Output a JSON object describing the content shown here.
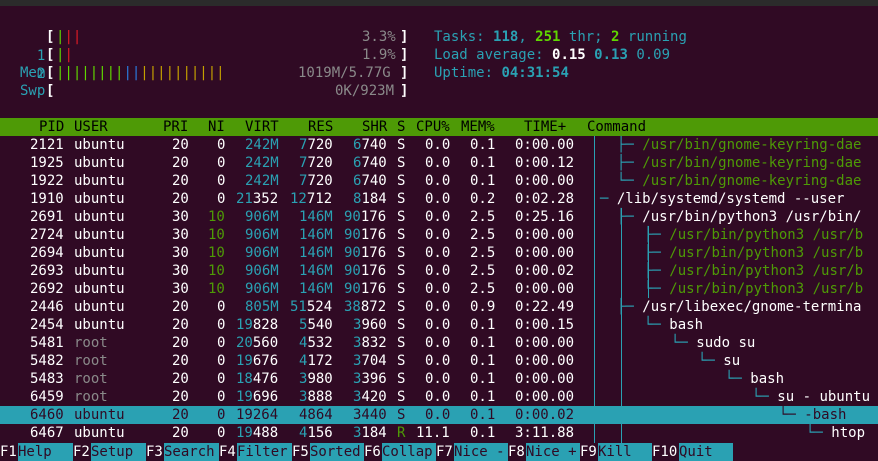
{
  "meters": {
    "cpu1": {
      "label": "1",
      "bars": "|||",
      "value": "3.3%"
    },
    "cpu2": {
      "label": "2",
      "bars": "||",
      "value": "1.9%"
    },
    "mem": {
      "label": "Mem",
      "bars": "||||||||||||||||||||",
      "value": "1019M/5.77G"
    },
    "swp": {
      "label": "Swp",
      "bars": "",
      "value": "0K/923M"
    }
  },
  "stats": {
    "tasks_label": "Tasks: ",
    "tasks": "118",
    "thr": "251",
    "thr_label": " thr; ",
    "running": "2",
    "running_label": " running",
    "load_label": "Load average: ",
    "load1": "0.15",
    "load5": "0.13",
    "load15": "0.09",
    "uptime_label": "Uptime: ",
    "uptime": "04:31:54"
  },
  "columns": [
    "PID",
    "USER",
    "PRI",
    "NI",
    "VIRT",
    "RES",
    "SHR",
    "S",
    "CPU%",
    "MEM%",
    "TIME+",
    "Command"
  ],
  "rows": [
    {
      "pid": "2121",
      "user": "ubuntu",
      "pri": "20",
      "ni": "0",
      "virt": "242M",
      "res": "7720",
      "shr": "6740",
      "s": "S",
      "cpu": "0.0",
      "mem": "0.1",
      "time": "0:00.00",
      "cmd": "/usr/bin/gnome-keyring-dae",
      "level": 1,
      "tree": "├─ ",
      "green": true
    },
    {
      "pid": "1925",
      "user": "ubuntu",
      "pri": "20",
      "ni": "0",
      "virt": "242M",
      "res": "7720",
      "shr": "6740",
      "s": "S",
      "cpu": "0.0",
      "mem": "0.1",
      "time": "0:00.12",
      "cmd": "/usr/bin/gnome-keyring-dae",
      "level": 1,
      "tree": "├─ ",
      "green": true
    },
    {
      "pid": "1922",
      "user": "ubuntu",
      "pri": "20",
      "ni": "0",
      "virt": "242M",
      "res": "7720",
      "shr": "6740",
      "s": "S",
      "cpu": "0.0",
      "mem": "0.1",
      "time": "0:00.00",
      "cmd": "/usr/bin/gnome-keyring-dae",
      "level": 1,
      "tree": "└─ ",
      "green": true
    },
    {
      "pid": "1910",
      "user": "ubuntu",
      "pri": "20",
      "ni": "0",
      "virt": "21352",
      "res": "12712",
      "shr": "8184",
      "s": "S",
      "cpu": "0.0",
      "mem": "0.2",
      "time": "0:02.28",
      "cmd": "/lib/systemd/systemd --user",
      "level": 0,
      "tree": "─ ",
      "green": false
    },
    {
      "pid": "2691",
      "user": "ubuntu",
      "pri": "30",
      "ni": "10",
      "virt": "906M",
      "res": "146M",
      "shr": "90176",
      "s": "S",
      "cpu": "0.0",
      "mem": "2.5",
      "time": "0:25.16",
      "cmd": "/usr/bin/python3 /usr/bin/",
      "level": 1,
      "tree": "├─ ",
      "green": false
    },
    {
      "pid": "2724",
      "user": "ubuntu",
      "pri": "30",
      "ni": "10",
      "virt": "906M",
      "res": "146M",
      "shr": "90176",
      "s": "S",
      "cpu": "0.0",
      "mem": "2.5",
      "time": "0:00.00",
      "cmd": "/usr/bin/python3 /usr/b",
      "level": 2,
      "tree": "├─ ",
      "green": true
    },
    {
      "pid": "2694",
      "user": "ubuntu",
      "pri": "30",
      "ni": "10",
      "virt": "906M",
      "res": "146M",
      "shr": "90176",
      "s": "S",
      "cpu": "0.0",
      "mem": "2.5",
      "time": "0:00.00",
      "cmd": "/usr/bin/python3 /usr/b",
      "level": 2,
      "tree": "├─ ",
      "green": true
    },
    {
      "pid": "2693",
      "user": "ubuntu",
      "pri": "30",
      "ni": "10",
      "virt": "906M",
      "res": "146M",
      "shr": "90176",
      "s": "S",
      "cpu": "0.0",
      "mem": "2.5",
      "time": "0:00.02",
      "cmd": "/usr/bin/python3 /usr/b",
      "level": 2,
      "tree": "├─ ",
      "green": true
    },
    {
      "pid": "2692",
      "user": "ubuntu",
      "pri": "30",
      "ni": "10",
      "virt": "906M",
      "res": "146M",
      "shr": "90176",
      "s": "S",
      "cpu": "0.0",
      "mem": "2.5",
      "time": "0:00.00",
      "cmd": "/usr/bin/python3 /usr/b",
      "level": 2,
      "tree": "└─ ",
      "green": true
    },
    {
      "pid": "2446",
      "user": "ubuntu",
      "pri": "20",
      "ni": "0",
      "virt": "805M",
      "res": "51524",
      "shr": "38872",
      "s": "S",
      "cpu": "0.0",
      "mem": "0.9",
      "time": "0:22.49",
      "cmd": "/usr/libexec/gnome-termina",
      "level": 1,
      "tree": "├─ ",
      "green": false
    },
    {
      "pid": "2454",
      "user": "ubuntu",
      "pri": "20",
      "ni": "0",
      "virt": "19828",
      "res": "5540",
      "shr": "3960",
      "s": "S",
      "cpu": "0.0",
      "mem": "0.1",
      "time": "0:00.15",
      "cmd": "bash",
      "level": 2,
      "tree": "└─ ",
      "green": false
    },
    {
      "pid": "5481",
      "user": "root",
      "pri": "20",
      "ni": "0",
      "virt": "20560",
      "res": "4532",
      "shr": "3832",
      "s": "S",
      "cpu": "0.0",
      "mem": "0.1",
      "time": "0:00.00",
      "cmd": "sudo su",
      "level": 3,
      "tree": "└─ ",
      "green": false
    },
    {
      "pid": "5482",
      "user": "root",
      "pri": "20",
      "ni": "0",
      "virt": "19676",
      "res": "4172",
      "shr": "3704",
      "s": "S",
      "cpu": "0.0",
      "mem": "0.1",
      "time": "0:00.00",
      "cmd": "su",
      "level": 4,
      "tree": "└─ ",
      "green": false
    },
    {
      "pid": "5483",
      "user": "root",
      "pri": "20",
      "ni": "0",
      "virt": "18476",
      "res": "3980",
      "shr": "3396",
      "s": "S",
      "cpu": "0.0",
      "mem": "0.1",
      "time": "0:00.00",
      "cmd": "bash",
      "level": 5,
      "tree": "└─ ",
      "green": false
    },
    {
      "pid": "6459",
      "user": "root",
      "pri": "20",
      "ni": "0",
      "virt": "19696",
      "res": "3888",
      "shr": "3420",
      "s": "S",
      "cpu": "0.0",
      "mem": "0.1",
      "time": "0:00.00",
      "cmd": "su - ubuntu",
      "level": 6,
      "tree": "└─ ",
      "green": false
    },
    {
      "pid": "6460",
      "user": "ubuntu",
      "pri": "20",
      "ni": "0",
      "virt": "19264",
      "res": "4864",
      "shr": "3440",
      "s": "S",
      "cpu": "0.0",
      "mem": "0.1",
      "time": "0:00.02",
      "cmd": "-bash",
      "level": 7,
      "tree": "└─ ",
      "green": false,
      "selected": true
    },
    {
      "pid": "6467",
      "user": "ubuntu",
      "pri": "20",
      "ni": "0",
      "virt": "19488",
      "res": "4156",
      "shr": "3184",
      "s": "R",
      "cpu": "11.1",
      "mem": "0.1",
      "time": "3:11.88",
      "cmd": "htop",
      "level": 8,
      "tree": "└─ ",
      "green": false
    }
  ],
  "fkeys": [
    {
      "key": "F1",
      "label": "Help"
    },
    {
      "key": "F2",
      "label": "Setup"
    },
    {
      "key": "F3",
      "label": "Search"
    },
    {
      "key": "F4",
      "label": "Filter"
    },
    {
      "key": "F5",
      "label": "Sorted"
    },
    {
      "key": "F6",
      "label": "Collap"
    },
    {
      "key": "F7",
      "label": "Nice -"
    },
    {
      "key": "F8",
      "label": "Nice +"
    },
    {
      "key": "F9",
      "label": "Kill"
    },
    {
      "key": "F10",
      "label": "Quit"
    }
  ]
}
